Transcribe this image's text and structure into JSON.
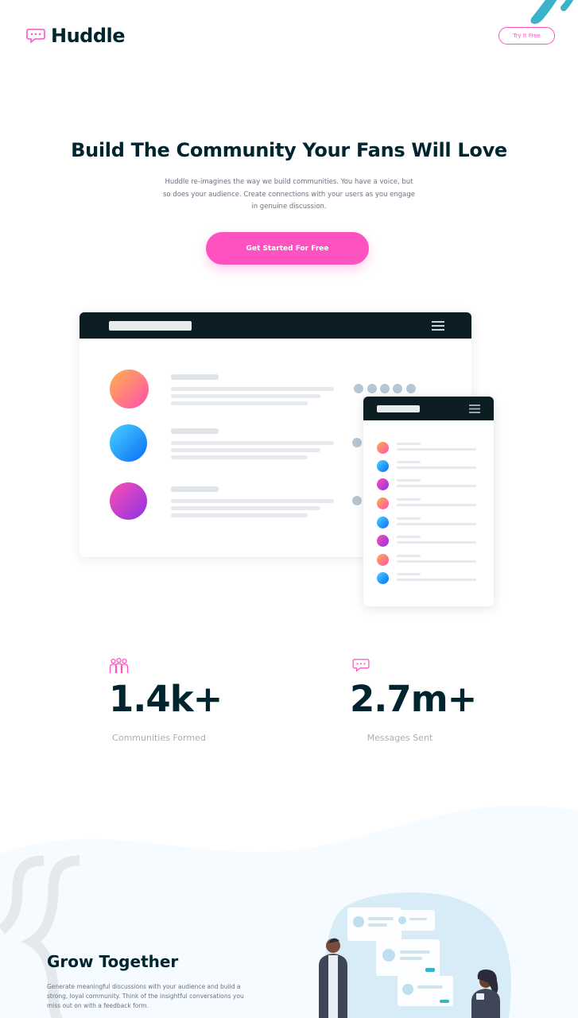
{
  "header": {
    "logo_text": "Huddle",
    "try_button": "Try It Free"
  },
  "hero": {
    "title": "Build The Community Your Fans Will Love",
    "description": "Huddle re-imagines the way we build communities. You have a voice, but so does your audience. Create connections with your users as you engage in genuine discussion.",
    "cta": "Get Started For Free"
  },
  "stats": [
    {
      "value": "1.4k+",
      "label": "Communities Formed",
      "icon": "communities-icon"
    },
    {
      "value": "2.7m+",
      "label": "Messages Sent",
      "icon": "messages-icon"
    }
  ],
  "grow": {
    "title": "Grow Together",
    "description": "Generate meaningful discussions with your audience and build a strong, loyal community. Think of the insightful conversations you miss out on with a feedback form."
  },
  "colors": {
    "brand_pink": "#ff52c1",
    "dark_navy": "#00252e",
    "light_blue_bg": "#f5fbff",
    "accent_teal": "#3ab2c9"
  }
}
